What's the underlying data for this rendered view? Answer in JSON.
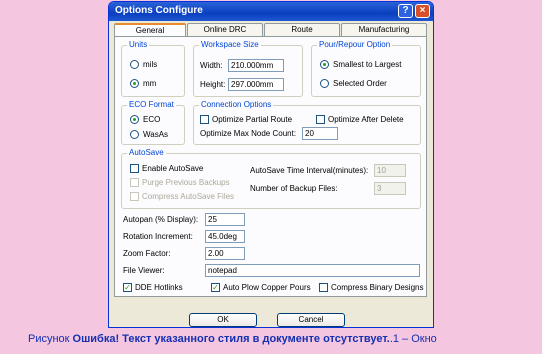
{
  "window": {
    "title": "Options Configure",
    "help_icon": "?",
    "close_icon": "×"
  },
  "tabs": [
    {
      "label": "General",
      "active": true
    },
    {
      "label": "Online DRC",
      "active": false
    },
    {
      "label": "Route",
      "active": false
    },
    {
      "label": "Manufacturing",
      "active": false
    }
  ],
  "units": {
    "title": "Units",
    "mils": "mils",
    "mm": "mm",
    "selected": "mm"
  },
  "workspace": {
    "title": "Workspace Size",
    "width_label": "Width:",
    "width_value": "210.000mm",
    "height_label": "Height:",
    "height_value": "297.000mm"
  },
  "pour": {
    "title": "Pour/Repour Option",
    "option1": "Smallest to Largest",
    "option2": "Selected Order",
    "selected": "Smallest to Largest"
  },
  "eco": {
    "title": "ECO Format",
    "option1": "ECO",
    "option2": "WasAs",
    "selected": "ECO"
  },
  "connection": {
    "title": "Connection Options",
    "optimize_partial": "Optimize Partial Route",
    "optimize_after_delete": "Optimize After Delete",
    "max_node_label": "Optimize Max Node Count:",
    "max_node_value": "20"
  },
  "autosave": {
    "title": "AutoSave",
    "enable": "Enable AutoSave",
    "purge": "Purge Previous Backups",
    "compress": "Compress AutoSave Files",
    "interval_label": "AutoSave Time Interval(minutes):",
    "interval_value": "10",
    "backup_label": "Number of Backup Files:",
    "backup_value": "3"
  },
  "fields": {
    "autopan_label": "Autopan (% Display):",
    "autopan_value": "25",
    "rotation_label": "Rotation Increment:",
    "rotation_value": "45.0deg",
    "zoom_label": "Zoom Factor:",
    "zoom_value": "2.00",
    "viewer_label": "File Viewer:",
    "viewer_value": "notepad"
  },
  "checks": {
    "dde": "DDE Hotlinks",
    "auto_plow": "Auto Plow Copper Pours",
    "compress_binary": "Compress Binary Designs"
  },
  "buttons": {
    "ok": "OK",
    "cancel": "Cancel"
  },
  "caption": {
    "prefix": "Рисунок ",
    "error": "Ошибка! Текст указанного стиля в документе отсутствует.",
    "suffix": ".1 – Окно"
  }
}
